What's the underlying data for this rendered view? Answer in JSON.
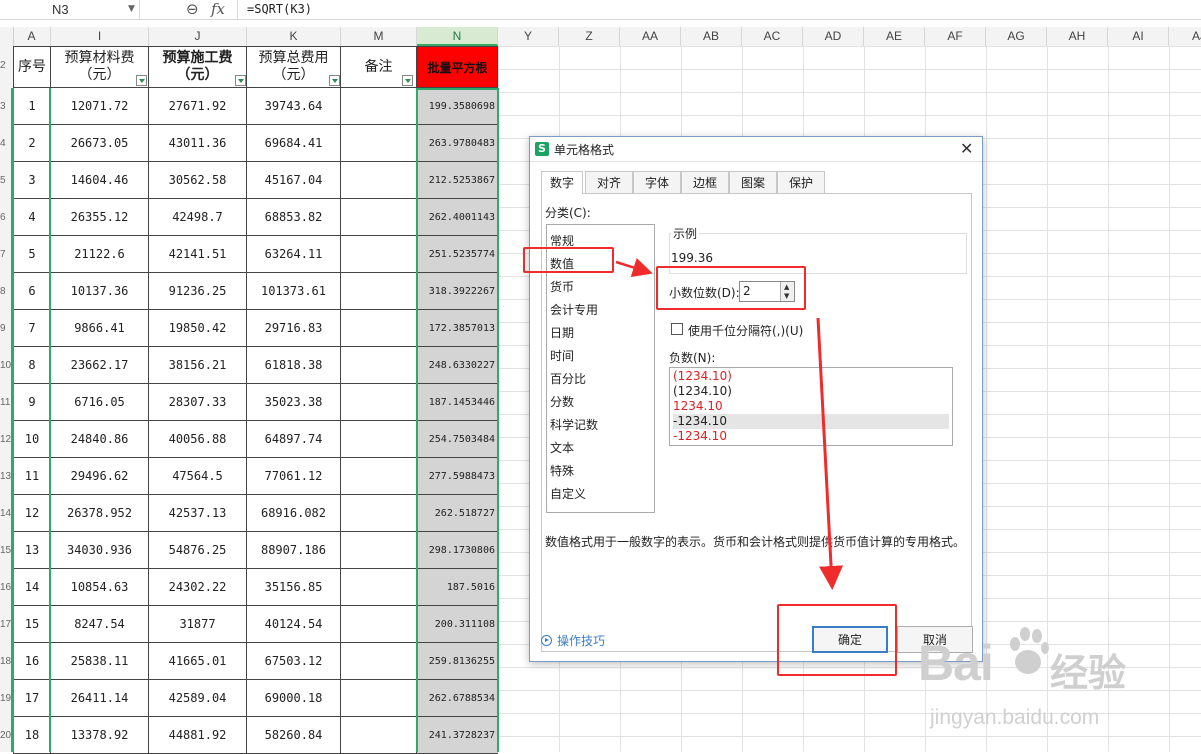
{
  "formula_bar": {
    "cell_ref": "N3",
    "formula": "=SQRT(K3)"
  },
  "column_headers": [
    "A",
    "I",
    "J",
    "K",
    "M",
    "N",
    "Y",
    "Z",
    "AA",
    "AB",
    "AC",
    "AD",
    "AE",
    "AF",
    "AG",
    "AH",
    "AI",
    "AJ"
  ],
  "table": {
    "headers": {
      "seq": "序号",
      "material": "预算材料费\n（元）",
      "construction": "预算施工费\n（元）",
      "total": "预算总费用\n（元）",
      "remark": "备注",
      "sqrt": "批量平方根"
    },
    "rows": [
      {
        "row": "3",
        "seq": "1",
        "material": "12071.72",
        "construction": "27671.92",
        "total": "39743.64",
        "sqrt": "199.3580698"
      },
      {
        "row": "4",
        "seq": "2",
        "material": "26673.05",
        "construction": "43011.36",
        "total": "69684.41",
        "sqrt": "263.9780483"
      },
      {
        "row": "5",
        "seq": "3",
        "material": "14604.46",
        "construction": "30562.58",
        "total": "45167.04",
        "sqrt": "212.5253867"
      },
      {
        "row": "6",
        "seq": "4",
        "material": "26355.12",
        "construction": "42498.7",
        "total": "68853.82",
        "sqrt": "262.4001143"
      },
      {
        "row": "7",
        "seq": "5",
        "material": "21122.6",
        "construction": "42141.51",
        "total": "63264.11",
        "sqrt": "251.5235774"
      },
      {
        "row": "8",
        "seq": "6",
        "material": "10137.36",
        "construction": "91236.25",
        "total": "101373.61",
        "sqrt": "318.3922267"
      },
      {
        "row": "9",
        "seq": "7",
        "material": "9866.41",
        "construction": "19850.42",
        "total": "29716.83",
        "sqrt": "172.3857013"
      },
      {
        "row": "10",
        "seq": "8",
        "material": "23662.17",
        "construction": "38156.21",
        "total": "61818.38",
        "sqrt": "248.6330227"
      },
      {
        "row": "11",
        "seq": "9",
        "material": "6716.05",
        "construction": "28307.33",
        "total": "35023.38",
        "sqrt": "187.1453446"
      },
      {
        "row": "12",
        "seq": "10",
        "material": "24840.86",
        "construction": "40056.88",
        "total": "64897.74",
        "sqrt": "254.7503484"
      },
      {
        "row": "13",
        "seq": "11",
        "material": "29496.62",
        "construction": "47564.5",
        "total": "77061.12",
        "sqrt": "277.5988473"
      },
      {
        "row": "14",
        "seq": "12",
        "material": "26378.952",
        "construction": "42537.13",
        "total": "68916.082",
        "sqrt": "262.518727"
      },
      {
        "row": "15",
        "seq": "13",
        "material": "34030.936",
        "construction": "54876.25",
        "total": "88907.186",
        "sqrt": "298.1730806"
      },
      {
        "row": "16",
        "seq": "14",
        "material": "10854.63",
        "construction": "24302.22",
        "total": "35156.85",
        "sqrt": "187.5016"
      },
      {
        "row": "17",
        "seq": "15",
        "material": "8247.54",
        "construction": "31877",
        "total": "40124.54",
        "sqrt": "200.311108"
      },
      {
        "row": "18",
        "seq": "16",
        "material": "25838.11",
        "construction": "41665.01",
        "total": "67503.12",
        "sqrt": "259.8136255"
      },
      {
        "row": "19",
        "seq": "17",
        "material": "26411.14",
        "construction": "42589.04",
        "total": "69000.18",
        "sqrt": "262.6788534"
      },
      {
        "row": "20",
        "seq": "18",
        "material": "13378.92",
        "construction": "44881.92",
        "total": "58260.84",
        "sqrt": "241.3728237"
      }
    ]
  },
  "dialog": {
    "title": "单元格格式",
    "close": "✕",
    "tabs": [
      "数字",
      "对齐",
      "字体",
      "边框",
      "图案",
      "保护"
    ],
    "category_label": "分类(C):",
    "categories": [
      "常规",
      "数值",
      "货币",
      "会计专用",
      "日期",
      "时间",
      "百分比",
      "分数",
      "科学记数",
      "文本",
      "特殊",
      "自定义"
    ],
    "selected_category": "数值",
    "sample_label": "示例",
    "sample_value": "199.36",
    "decimal_label": "小数位数(D):",
    "decimal_value": "2",
    "thousands_label": "使用千位分隔符(,)(U)",
    "negative_label": "负数(N):",
    "negative_options": [
      "(1234.10)",
      "(1234.10)",
      "1234.10",
      "-1234.10",
      "-1234.10"
    ],
    "negative_colors": [
      "#e02020",
      "#222222",
      "#e02020",
      "#222222",
      "#e02020"
    ],
    "description": "数值格式用于一般数字的表示。货币和会计格式则提供货币值计算的专用格式。",
    "tips": "操作技巧",
    "ok": "确定",
    "cancel": "取消"
  },
  "watermark": {
    "brand": "Bai",
    "cn": "经验",
    "url": "jingyan.baidu.com"
  },
  "colors": {
    "accent_green": "#2eaa6c",
    "header_red": "#ff0000",
    "annotation_red": "#ef2b2b"
  }
}
